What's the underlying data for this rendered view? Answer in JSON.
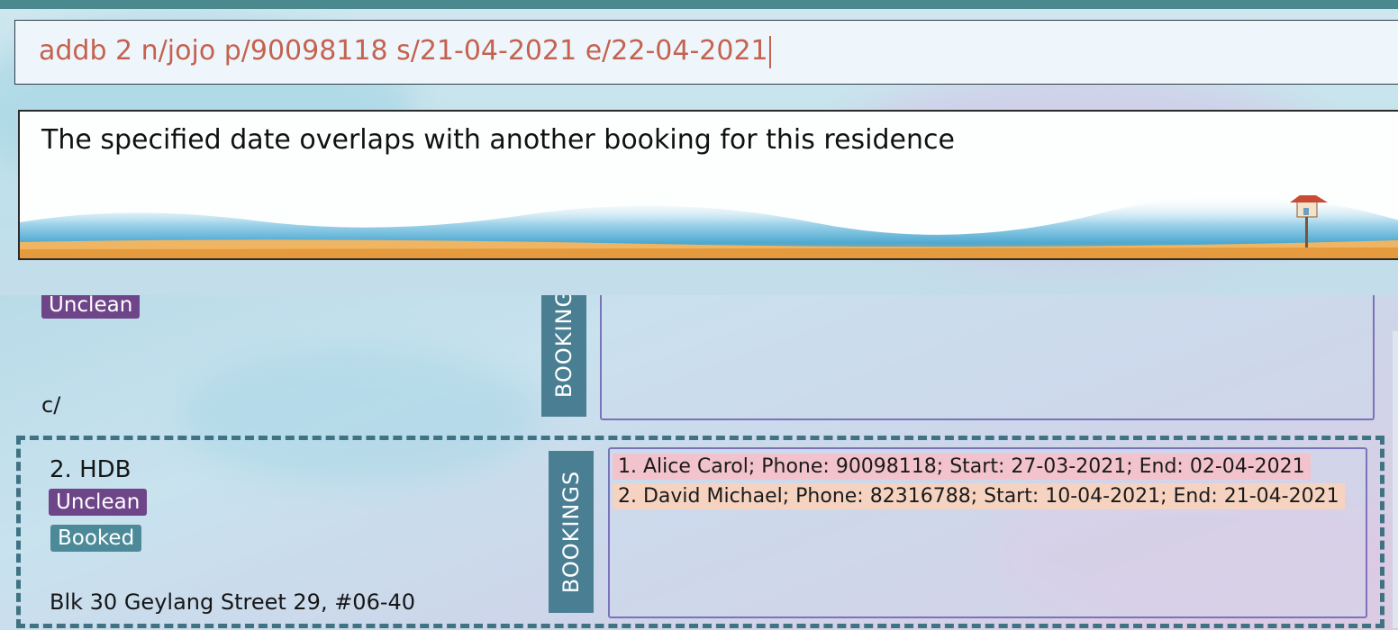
{
  "command_box": {
    "value": "addb 2 n/jojo p/90098118 s/21-04-2021 e/22-04-2021"
  },
  "result_box": {
    "message": "The specified date overlaps with another booking for this residence"
  },
  "residence_list": {
    "partial_card": {
      "tags": [
        "Unclean"
      ],
      "bookings_label": "BOOKING",
      "footer_text": "c/"
    },
    "card": {
      "index_name": "2.  HDB",
      "tags": [
        "Unclean",
        "Booked"
      ],
      "address": "Blk 30 Geylang Street 29, #06-40",
      "bookings_label": "BOOKINGS",
      "bookings": [
        "1. Alice Carol; Phone: 90098118; Start: 27-03-2021; End: 02-04-2021",
        "2. David Michael; Phone: 82316788; Start: 10-04-2021; End: 21-04-2021"
      ]
    }
  },
  "colors": {
    "unclean_tag": "#6f4589",
    "booked_tag": "#4d8a99",
    "command_text": "#c4624f",
    "booking1_highlight": "#f2c3cc",
    "booking2_highlight": "#f6d3c0"
  }
}
